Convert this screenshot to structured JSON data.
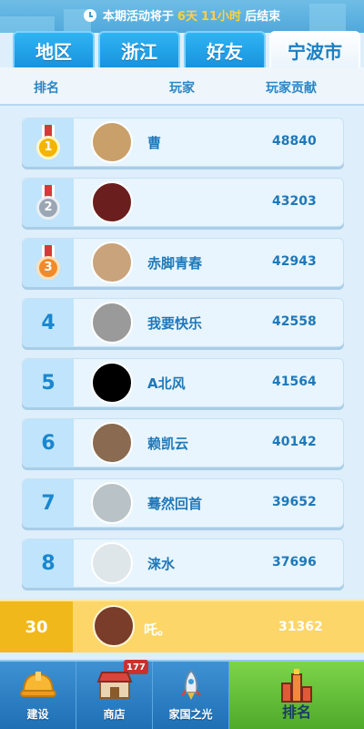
{
  "banner": {
    "prefix": "本期活动将于",
    "days": "6天",
    "hours": "11小时",
    "suffix": "后结束"
  },
  "tabs": [
    {
      "label": "地区",
      "active": false
    },
    {
      "label": "浙江",
      "active": false
    },
    {
      "label": "好友",
      "active": false
    },
    {
      "label": "宁波市",
      "active": true
    }
  ],
  "columns": {
    "rank": "排名",
    "player": "玩家",
    "score": "玩家贡献"
  },
  "rows": [
    {
      "rank": "1",
      "medal": "gold",
      "name": "曹",
      "score": "48840",
      "avatar_color": "#caa06a"
    },
    {
      "rank": "2",
      "medal": "silver",
      "name": "",
      "score": "43203",
      "avatar_color": "#6b1e1e"
    },
    {
      "rank": "3",
      "medal": "bronze",
      "name": "赤脚青春",
      "score": "42943",
      "avatar_color": "#c9a37c"
    },
    {
      "rank": "4",
      "medal": "",
      "name": "我要快乐",
      "score": "42558",
      "avatar_color": "#9a9a9a"
    },
    {
      "rank": "5",
      "medal": "",
      "name": "A北风",
      "score": "41564",
      "avatar_color": "#000000"
    },
    {
      "rank": "6",
      "medal": "",
      "name": "赖凯云",
      "score": "40142",
      "avatar_color": "#8a6a50"
    },
    {
      "rank": "7",
      "medal": "",
      "name": "蓦然回首",
      "score": "39652",
      "avatar_color": "#b9c2c6"
    },
    {
      "rank": "8",
      "medal": "",
      "name": "涞水",
      "score": "37696",
      "avatar_color": "#dfe6ea"
    }
  ],
  "me": {
    "rank": "30",
    "name": "吒。",
    "score": "31362",
    "avatar_color": "#7a3d2a"
  },
  "nav": [
    {
      "label": "建设",
      "icon": "hardhat-icon"
    },
    {
      "label": "商店",
      "icon": "shop-icon",
      "badge": "177"
    },
    {
      "label": "家国之光",
      "icon": "rocket-icon"
    },
    {
      "label": "排名",
      "icon": "ranking-icon",
      "active": true
    }
  ],
  "colors": {
    "accent": "#1b87cf",
    "highlight": "#ffd23a",
    "my_row": "#fcd668",
    "nav_active": "#6cc23f"
  }
}
